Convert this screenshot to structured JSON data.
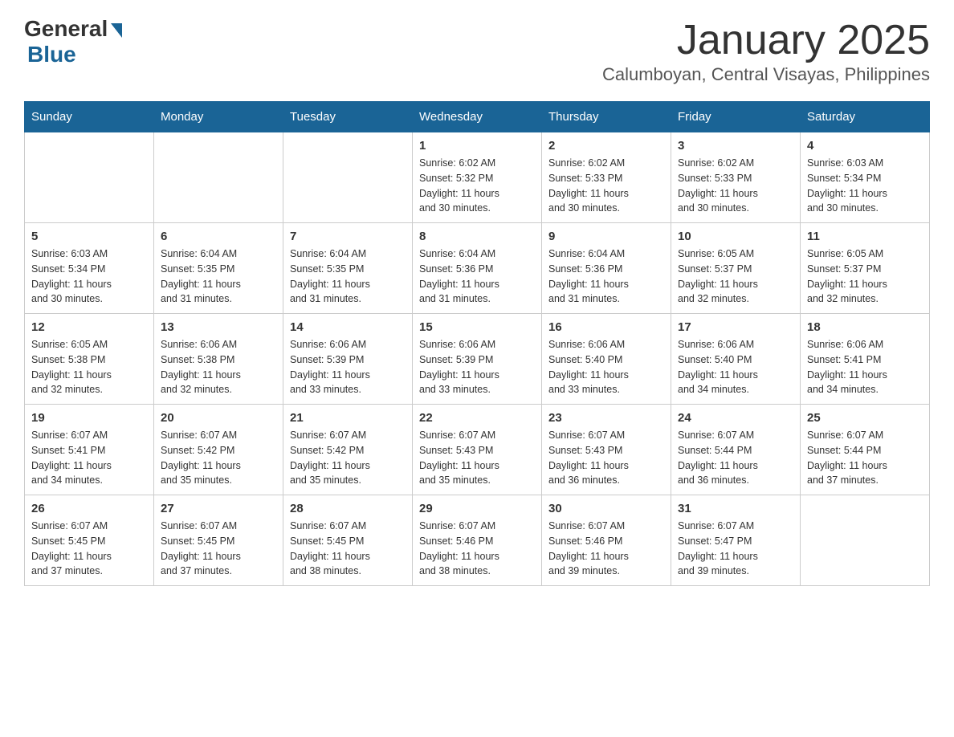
{
  "header": {
    "logo_general": "General",
    "logo_blue": "Blue",
    "month_title": "January 2025",
    "location": "Calumboyan, Central Visayas, Philippines"
  },
  "weekdays": [
    "Sunday",
    "Monday",
    "Tuesday",
    "Wednesday",
    "Thursday",
    "Friday",
    "Saturday"
  ],
  "weeks": [
    [
      {
        "day": "",
        "info": ""
      },
      {
        "day": "",
        "info": ""
      },
      {
        "day": "",
        "info": ""
      },
      {
        "day": "1",
        "info": "Sunrise: 6:02 AM\nSunset: 5:32 PM\nDaylight: 11 hours\nand 30 minutes."
      },
      {
        "day": "2",
        "info": "Sunrise: 6:02 AM\nSunset: 5:33 PM\nDaylight: 11 hours\nand 30 minutes."
      },
      {
        "day": "3",
        "info": "Sunrise: 6:02 AM\nSunset: 5:33 PM\nDaylight: 11 hours\nand 30 minutes."
      },
      {
        "day": "4",
        "info": "Sunrise: 6:03 AM\nSunset: 5:34 PM\nDaylight: 11 hours\nand 30 minutes."
      }
    ],
    [
      {
        "day": "5",
        "info": "Sunrise: 6:03 AM\nSunset: 5:34 PM\nDaylight: 11 hours\nand 30 minutes."
      },
      {
        "day": "6",
        "info": "Sunrise: 6:04 AM\nSunset: 5:35 PM\nDaylight: 11 hours\nand 31 minutes."
      },
      {
        "day": "7",
        "info": "Sunrise: 6:04 AM\nSunset: 5:35 PM\nDaylight: 11 hours\nand 31 minutes."
      },
      {
        "day": "8",
        "info": "Sunrise: 6:04 AM\nSunset: 5:36 PM\nDaylight: 11 hours\nand 31 minutes."
      },
      {
        "day": "9",
        "info": "Sunrise: 6:04 AM\nSunset: 5:36 PM\nDaylight: 11 hours\nand 31 minutes."
      },
      {
        "day": "10",
        "info": "Sunrise: 6:05 AM\nSunset: 5:37 PM\nDaylight: 11 hours\nand 32 minutes."
      },
      {
        "day": "11",
        "info": "Sunrise: 6:05 AM\nSunset: 5:37 PM\nDaylight: 11 hours\nand 32 minutes."
      }
    ],
    [
      {
        "day": "12",
        "info": "Sunrise: 6:05 AM\nSunset: 5:38 PM\nDaylight: 11 hours\nand 32 minutes."
      },
      {
        "day": "13",
        "info": "Sunrise: 6:06 AM\nSunset: 5:38 PM\nDaylight: 11 hours\nand 32 minutes."
      },
      {
        "day": "14",
        "info": "Sunrise: 6:06 AM\nSunset: 5:39 PM\nDaylight: 11 hours\nand 33 minutes."
      },
      {
        "day": "15",
        "info": "Sunrise: 6:06 AM\nSunset: 5:39 PM\nDaylight: 11 hours\nand 33 minutes."
      },
      {
        "day": "16",
        "info": "Sunrise: 6:06 AM\nSunset: 5:40 PM\nDaylight: 11 hours\nand 33 minutes."
      },
      {
        "day": "17",
        "info": "Sunrise: 6:06 AM\nSunset: 5:40 PM\nDaylight: 11 hours\nand 34 minutes."
      },
      {
        "day": "18",
        "info": "Sunrise: 6:06 AM\nSunset: 5:41 PM\nDaylight: 11 hours\nand 34 minutes."
      }
    ],
    [
      {
        "day": "19",
        "info": "Sunrise: 6:07 AM\nSunset: 5:41 PM\nDaylight: 11 hours\nand 34 minutes."
      },
      {
        "day": "20",
        "info": "Sunrise: 6:07 AM\nSunset: 5:42 PM\nDaylight: 11 hours\nand 35 minutes."
      },
      {
        "day": "21",
        "info": "Sunrise: 6:07 AM\nSunset: 5:42 PM\nDaylight: 11 hours\nand 35 minutes."
      },
      {
        "day": "22",
        "info": "Sunrise: 6:07 AM\nSunset: 5:43 PM\nDaylight: 11 hours\nand 35 minutes."
      },
      {
        "day": "23",
        "info": "Sunrise: 6:07 AM\nSunset: 5:43 PM\nDaylight: 11 hours\nand 36 minutes."
      },
      {
        "day": "24",
        "info": "Sunrise: 6:07 AM\nSunset: 5:44 PM\nDaylight: 11 hours\nand 36 minutes."
      },
      {
        "day": "25",
        "info": "Sunrise: 6:07 AM\nSunset: 5:44 PM\nDaylight: 11 hours\nand 37 minutes."
      }
    ],
    [
      {
        "day": "26",
        "info": "Sunrise: 6:07 AM\nSunset: 5:45 PM\nDaylight: 11 hours\nand 37 minutes."
      },
      {
        "day": "27",
        "info": "Sunrise: 6:07 AM\nSunset: 5:45 PM\nDaylight: 11 hours\nand 37 minutes."
      },
      {
        "day": "28",
        "info": "Sunrise: 6:07 AM\nSunset: 5:45 PM\nDaylight: 11 hours\nand 38 minutes."
      },
      {
        "day": "29",
        "info": "Sunrise: 6:07 AM\nSunset: 5:46 PM\nDaylight: 11 hours\nand 38 minutes."
      },
      {
        "day": "30",
        "info": "Sunrise: 6:07 AM\nSunset: 5:46 PM\nDaylight: 11 hours\nand 39 minutes."
      },
      {
        "day": "31",
        "info": "Sunrise: 6:07 AM\nSunset: 5:47 PM\nDaylight: 11 hours\nand 39 minutes."
      },
      {
        "day": "",
        "info": ""
      }
    ]
  ]
}
